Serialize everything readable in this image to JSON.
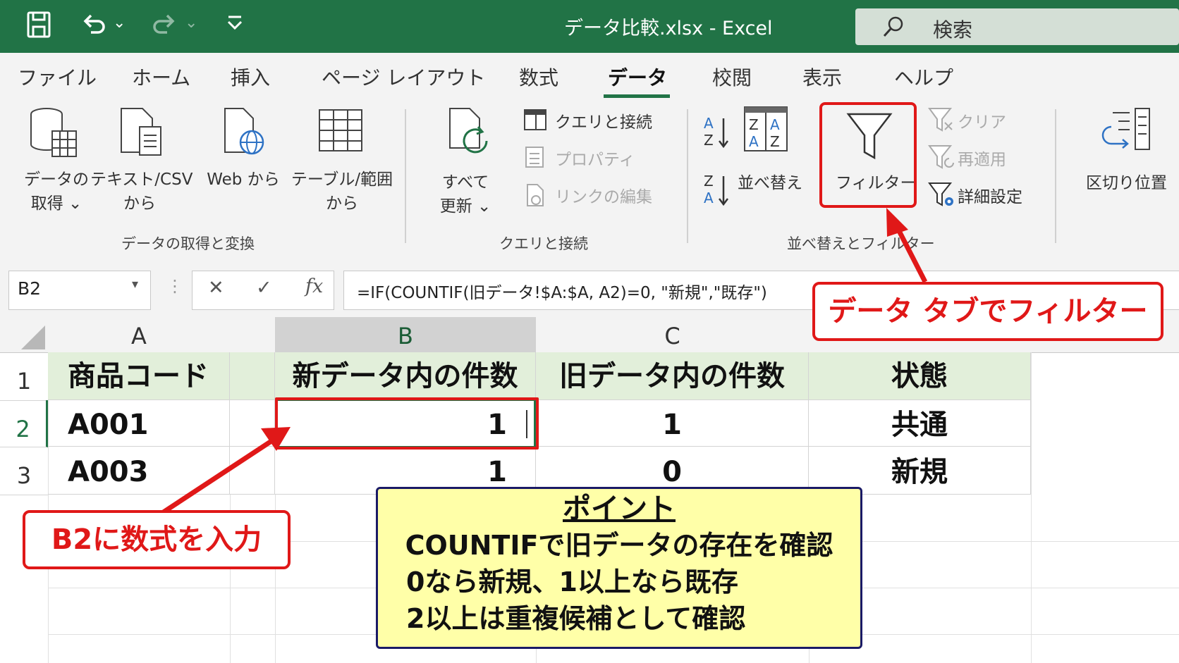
{
  "window": {
    "title": "データ比較.xlsx  -  Excel",
    "search_label": "検索"
  },
  "tabs": [
    "ファイル",
    "ホーム",
    "挿入",
    "ページ レイアウト",
    "数式",
    "データ",
    "校閲",
    "表示",
    "ヘルプ"
  ],
  "active_tab": "データ",
  "ribbon": {
    "get_data": {
      "line1": "データの",
      "line2": "取得 ⌄"
    },
    "text_csv": {
      "line1": "テキスト/CSV",
      "line2": "から"
    },
    "web": {
      "line1": "Web から"
    },
    "table_range": {
      "line1": "テーブル/範囲",
      "line2": "から"
    },
    "group1": "データの取得と変換",
    "refresh": {
      "line1": "すべて",
      "line2": "更新 ⌄"
    },
    "queries": "クエリと接続",
    "properties": "プロパティ",
    "edit_links": "リンクの編集",
    "group2": "クエリと接続",
    "sort": "並べ替え",
    "filter": "フィルター",
    "clear": "クリア",
    "reapply": "再適用",
    "advanced": "詳細設定",
    "group3": "並べ替えとフィルター",
    "text_to_columns": "区切り位置"
  },
  "formula_bar": {
    "name_box": "B2",
    "cancel": "✕",
    "enter": "✓",
    "fx": "fx",
    "formula": "=IF(COUNTIF(旧データ!$A:$A, A2)=0, \"新規\",\"既存\")"
  },
  "sheet": {
    "columns": [
      "A",
      "B",
      "C"
    ],
    "rows": [
      "1",
      "2",
      "3"
    ],
    "header": [
      "商品コード",
      "新データ内の件数",
      "旧データ内の件数",
      "状態"
    ],
    "data": [
      [
        "A001",
        "1",
        "1",
        "共通"
      ],
      [
        "A003",
        "1",
        "0",
        "新規"
      ]
    ]
  },
  "annotations": {
    "data_tab_label": "データ タブでフィルター",
    "b2_label": "B2に数式を入力",
    "point_title": "ポイント",
    "point_lines": [
      "COUNTIFで旧データの存在を確認",
      "0なら新規、1以上なら既存",
      "2以上は重複候補として確認"
    ]
  },
  "colors": {
    "excel_green": "#217346",
    "header_fill": "#e2efda",
    "annotation_red": "#e01818",
    "point_fill": "#ffffa8"
  }
}
